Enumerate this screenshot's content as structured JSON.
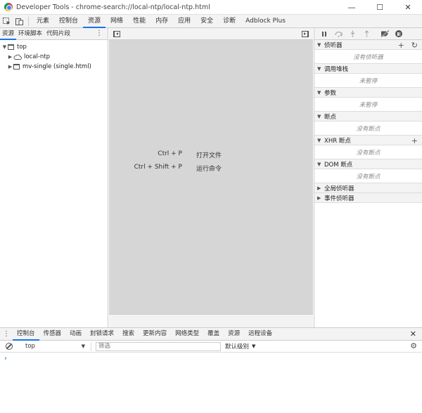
{
  "window": {
    "title": "Developer Tools - chrome-search://local-ntp/local-ntp.html",
    "minimize_glyph": "—",
    "maximize_glyph": "☐",
    "close_glyph": "✕"
  },
  "main_tabs": [
    {
      "label": "元素",
      "active": false
    },
    {
      "label": "控制台",
      "active": false
    },
    {
      "label": "资源",
      "active": true
    },
    {
      "label": "网络",
      "active": false
    },
    {
      "label": "性能",
      "active": false
    },
    {
      "label": "内存",
      "active": false
    },
    {
      "label": "应用",
      "active": false
    },
    {
      "label": "安全",
      "active": false
    },
    {
      "label": "诊断",
      "active": false
    },
    {
      "label": "Adblock Plus",
      "active": false
    }
  ],
  "navigator": {
    "tabs": [
      "资源",
      "环境脚本",
      "代码片段"
    ],
    "more_glyph": "⋮",
    "tree": [
      {
        "label": "top",
        "icon": "frame-icon",
        "expanded": true,
        "level": 0
      },
      {
        "label": "local-ntp",
        "icon": "cloud-icon",
        "expanded": false,
        "level": 1
      },
      {
        "label": "mv-single (single.html)",
        "icon": "frame-icon",
        "expanded": false,
        "level": 1
      }
    ]
  },
  "editor": {
    "shortcuts": [
      {
        "key": "Ctrl + P",
        "action": "打开文件"
      },
      {
        "key": "Ctrl + Shift + P",
        "action": "运行命令"
      }
    ]
  },
  "debugger": {
    "sections": [
      {
        "title": "侦听器",
        "expanded": true,
        "body": "没有侦听器",
        "actions": [
          "+",
          "↻"
        ]
      },
      {
        "title": "调用堆栈",
        "expanded": true,
        "body": "未暂停",
        "actions": []
      },
      {
        "title": "参数",
        "expanded": true,
        "body": "未暂停",
        "actions": []
      },
      {
        "title": "断点",
        "expanded": true,
        "body": "没有断点",
        "actions": []
      },
      {
        "title": "XHR 断点",
        "expanded": true,
        "body": "没有断点",
        "actions": [
          "+"
        ]
      },
      {
        "title": "DOM 断点",
        "expanded": true,
        "body": "没有断点",
        "actions": []
      },
      {
        "title": "全局侦听器",
        "expanded": false,
        "body": "",
        "actions": []
      },
      {
        "title": "事件侦听器",
        "expanded": false,
        "body": "",
        "actions": []
      }
    ]
  },
  "drawer": {
    "more_glyph": "⋮",
    "tabs": [
      {
        "label": "控制台",
        "active": true
      },
      {
        "label": "传感器",
        "active": false
      },
      {
        "label": "动画",
        "active": false
      },
      {
        "label": "封锁请求",
        "active": false
      },
      {
        "label": "搜索",
        "active": false
      },
      {
        "label": "更新内容",
        "active": false
      },
      {
        "label": "网络类型",
        "active": false
      },
      {
        "label": "覆盖",
        "active": false
      },
      {
        "label": "资源",
        "active": false
      },
      {
        "label": "远程设备",
        "active": false
      }
    ],
    "close_glyph": "✕"
  },
  "console": {
    "context": "top",
    "filter_placeholder": "筛选",
    "levels_label": "默认级别",
    "prompt_glyph": "›"
  },
  "colors": {
    "accent": "#1a73e8",
    "editor_bg": "#d6d6d6",
    "toolbar_bg": "#f3f3f3"
  }
}
